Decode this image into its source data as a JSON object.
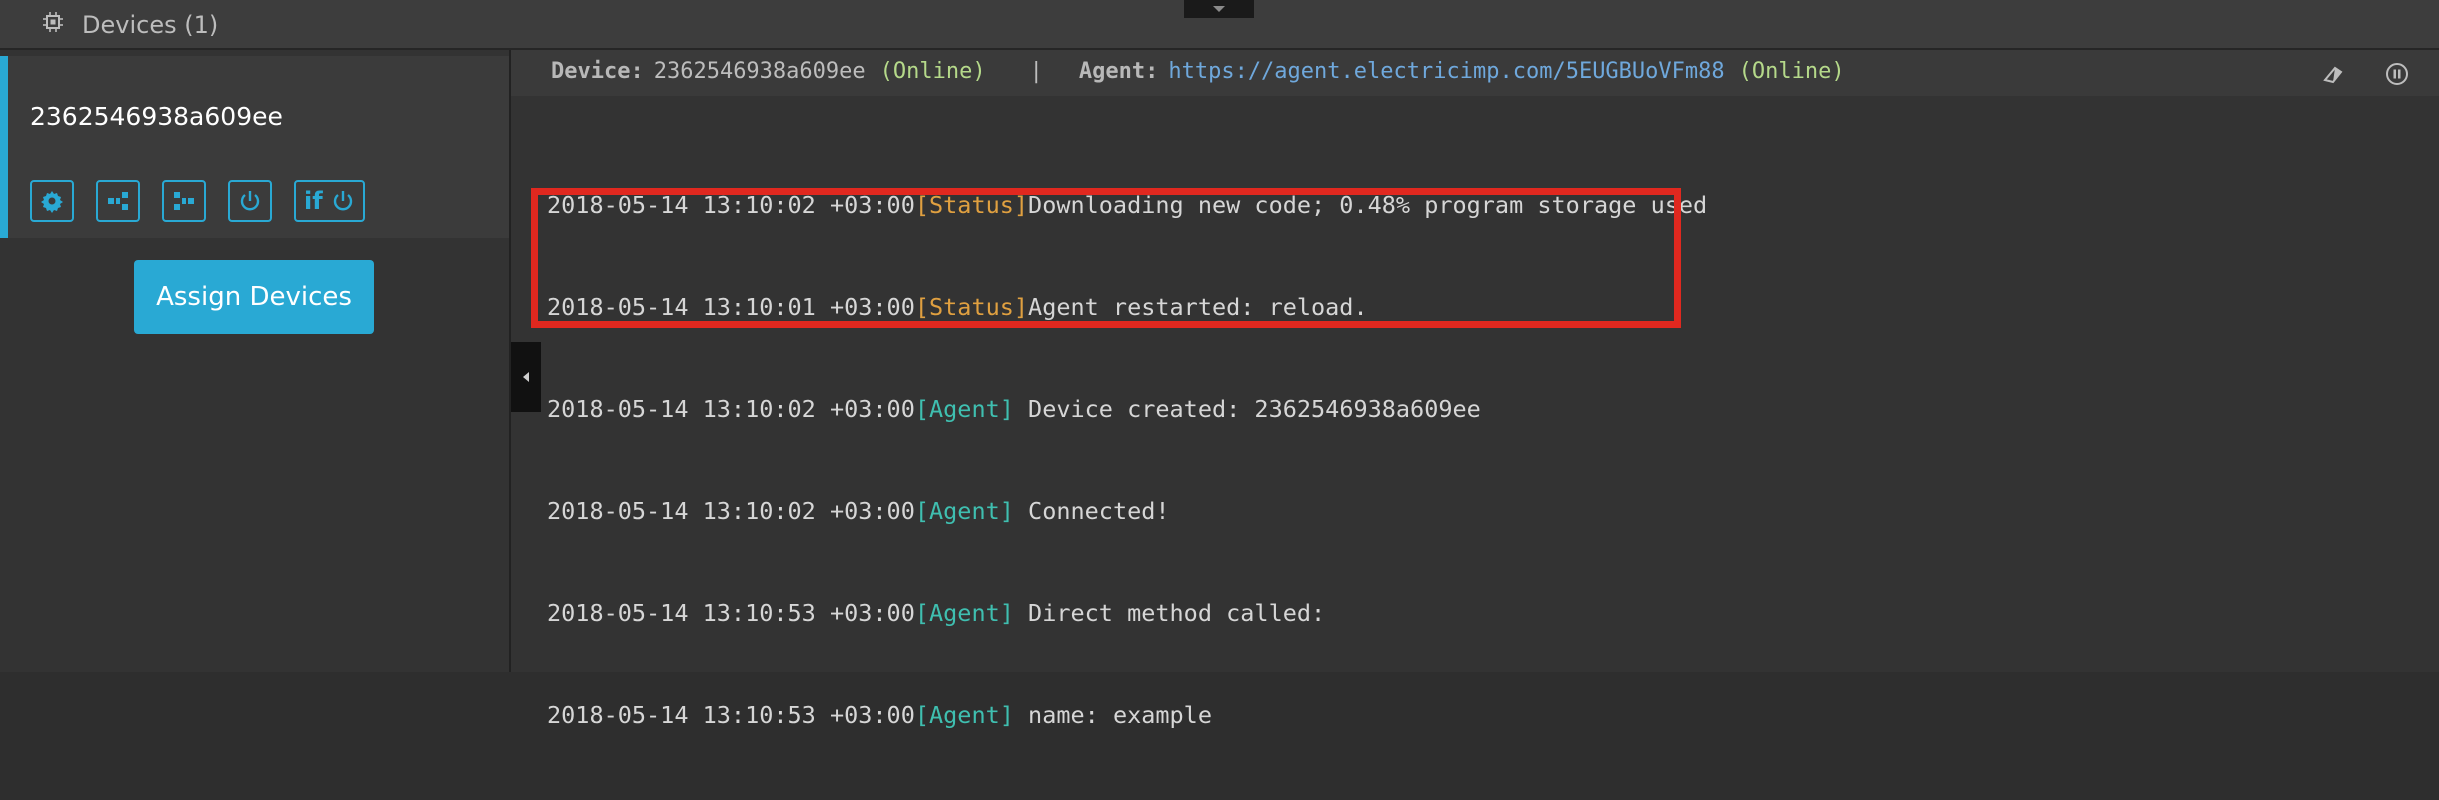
{
  "header": {
    "title": "Devices (1)",
    "icon": "chip-icon"
  },
  "device": {
    "name": "2362546938a609ee",
    "actions": [
      {
        "icon": "gear-icon"
      },
      {
        "icon": "tree-right-icon"
      },
      {
        "icon": "tree-left-icon"
      },
      {
        "icon": "power-icon"
      },
      {
        "label": "if",
        "icon": "power-icon"
      }
    ]
  },
  "assign_button": {
    "label": "Assign Devices"
  },
  "log_header": {
    "device_label": "Device:",
    "device_id": "2362546938a609ee",
    "device_status": "(Online)",
    "separator": "|",
    "agent_label": "Agent:",
    "agent_url": "https://agent.electricimp.com/5EUGBUoVFm88",
    "agent_status": "(Online)",
    "icons": [
      "eraser-icon",
      "pause-icon"
    ]
  },
  "log": [
    {
      "timestamp": "2018-05-14 13:10:02 +03:00",
      "tag": "[Status]",
      "message": "Downloading new code; 0.48% program storage used"
    },
    {
      "timestamp": "2018-05-14 13:10:01 +03:00",
      "tag": "[Status]",
      "message": "Agent restarted: reload."
    },
    {
      "timestamp": "2018-05-14 13:10:02 +03:00",
      "tag": "[Agent]",
      "message": " Device created: 2362546938a609ee"
    },
    {
      "timestamp": "2018-05-14 13:10:02 +03:00",
      "tag": "[Agent]",
      "message": " Connected!"
    },
    {
      "timestamp": "2018-05-14 13:10:53 +03:00",
      "tag": "[Agent]",
      "message": " Direct method called:"
    },
    {
      "timestamp": "2018-05-14 13:10:53 +03:00",
      "tag": "[Agent]",
      "message": " name: example"
    }
  ],
  "colors": {
    "accent": "#29a9d4",
    "status_tag": "#e0a040",
    "agent_tag": "#3fbfb0",
    "online": "#b5d98a",
    "link": "#6fa8dc",
    "highlight": "#e0281f"
  }
}
